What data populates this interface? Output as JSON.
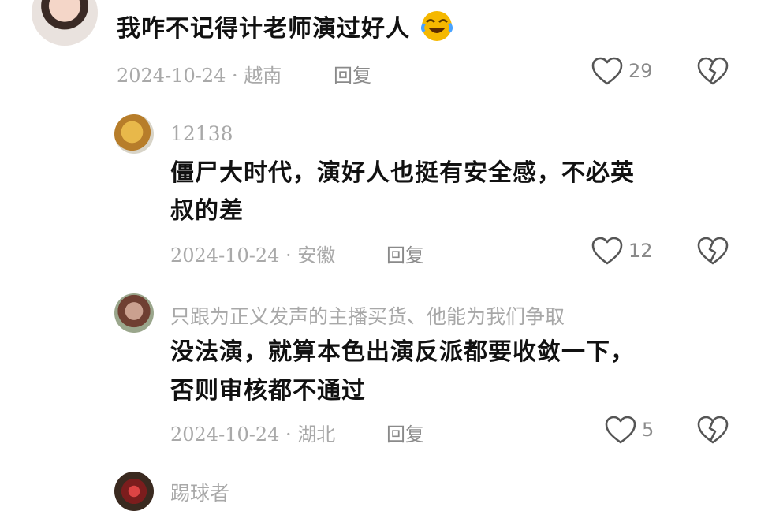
{
  "comments": [
    {
      "text": "我咋不记得计老师演过好人",
      "emoji_icon": "laughing-tears-emoji",
      "date_location": "2024-10-24 · 越南",
      "reply_label": "回复",
      "likes": "29"
    },
    {
      "username": "12138",
      "text_line1": "僵尸大时代，演好人也挺有安全感，不必英",
      "text_line2": "叔的差",
      "date_location": "2024-10-24 · 安徽",
      "reply_label": "回复",
      "likes": "12"
    },
    {
      "username": "只跟为正义发声的主播买货、他能为我们争取",
      "text_line1": "没法演，就算本色出演反派都要收敛一下，",
      "text_line2": "否则审核都不通过",
      "date_location": "2024-10-24 · 湖北",
      "reply_label": "回复",
      "likes": "5"
    },
    {
      "username": "踢球者"
    }
  ],
  "colors": {
    "meta": "#a9a9a9",
    "icon_stroke": "#555555",
    "emoji": "#f5b800"
  }
}
